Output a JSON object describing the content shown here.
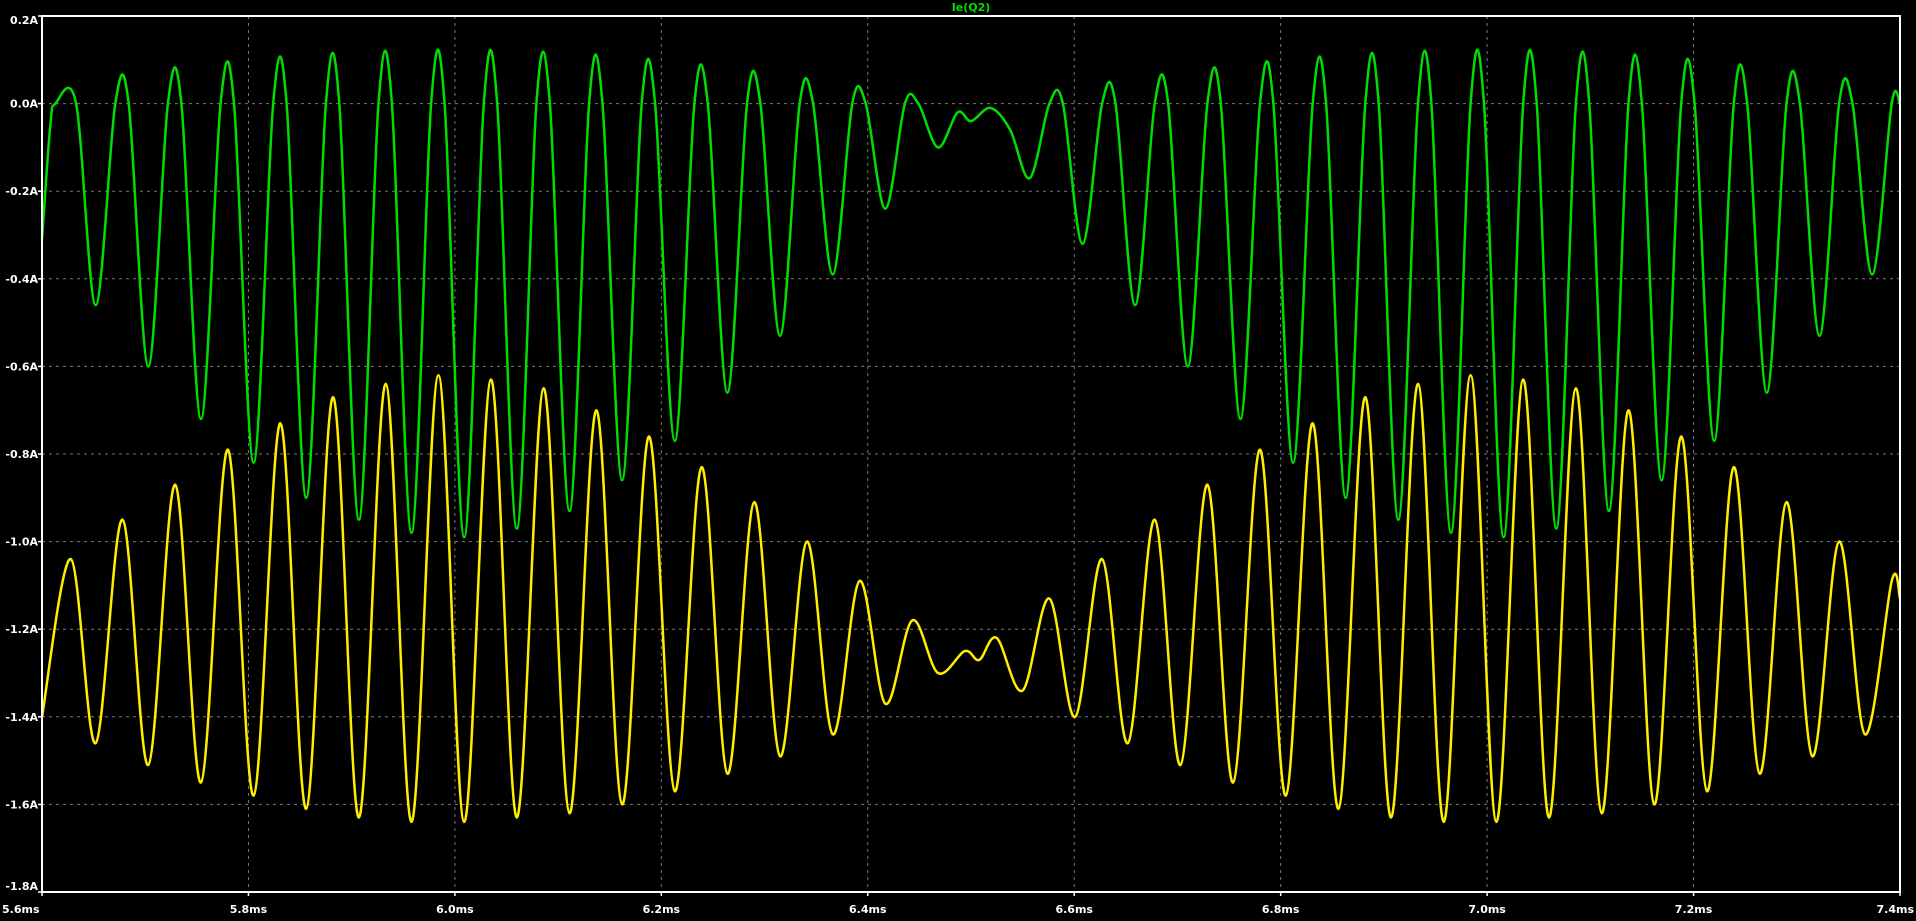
{
  "chart_data": {
    "type": "line",
    "title": "",
    "xlabel": "",
    "ylabel": "",
    "xlim": [
      5.6,
      7.4
    ],
    "ylim": [
      -1.8,
      0.2
    ],
    "grid": true,
    "x_ticks": [
      {
        "value": 5.6,
        "label": "5.6ms"
      },
      {
        "value": 5.8,
        "label": "5.8ms"
      },
      {
        "value": 6.0,
        "label": "6.0ms"
      },
      {
        "value": 6.2,
        "label": "6.2ms"
      },
      {
        "value": 6.4,
        "label": "6.4ms"
      },
      {
        "value": 6.6,
        "label": "6.6ms"
      },
      {
        "value": 6.8,
        "label": "6.8ms"
      },
      {
        "value": 7.0,
        "label": "7.0ms"
      },
      {
        "value": 7.2,
        "label": "7.2ms"
      },
      {
        "value": 7.4,
        "label": "7.4ms"
      }
    ],
    "y_ticks": [
      {
        "value": 0.2,
        "label": "0.2A"
      },
      {
        "value": 0.0,
        "label": "0.0A"
      },
      {
        "value": -0.2,
        "label": "-0.2A"
      },
      {
        "value": -0.4,
        "label": "-0.4A"
      },
      {
        "value": -0.6,
        "label": "-0.6A"
      },
      {
        "value": -0.8,
        "label": "-0.8A"
      },
      {
        "value": -1.0,
        "label": "-1.0A"
      },
      {
        "value": -1.2,
        "label": "-1.2A"
      },
      {
        "value": -1.4,
        "label": "-1.4A"
      },
      {
        "value": -1.6,
        "label": "-1.6A"
      },
      {
        "value": -1.8,
        "label": "-1.8A"
      }
    ],
    "legend": {
      "position": "top-center",
      "entries": [
        "Ie(Q2)"
      ]
    },
    "series": [
      {
        "name": "Ie(Q2)",
        "color": "#00dd00",
        "points": [
          [
            5.6,
            -0.31
          ],
          [
            5.608,
            -0.05
          ],
          [
            5.613,
            0.0
          ],
          [
            5.633,
            0.0
          ],
          [
            5.652,
            -0.46
          ],
          [
            5.671,
            0.0
          ],
          [
            5.684,
            0.0
          ],
          [
            5.703,
            -0.6
          ],
          [
            5.722,
            0.0
          ],
          [
            5.735,
            0.0
          ],
          [
            5.754,
            -0.72
          ],
          [
            5.773,
            0.0
          ],
          [
            5.786,
            0.0
          ],
          [
            5.805,
            -0.82
          ],
          [
            5.824,
            0.0
          ],
          [
            5.837,
            0.0
          ],
          [
            5.856,
            -0.9
          ],
          [
            5.875,
            0.0
          ],
          [
            5.888,
            0.0
          ],
          [
            5.907,
            -0.95
          ],
          [
            5.926,
            0.0
          ],
          [
            5.939,
            0.0
          ],
          [
            5.958,
            -0.98
          ],
          [
            5.977,
            0.0
          ],
          [
            5.99,
            0.0
          ],
          [
            6.009,
            -0.99
          ],
          [
            6.028,
            0.0
          ],
          [
            6.041,
            0.0
          ],
          [
            6.06,
            -0.97
          ],
          [
            6.079,
            0.0
          ],
          [
            6.092,
            0.0
          ],
          [
            6.111,
            -0.93
          ],
          [
            6.13,
            0.0
          ],
          [
            6.143,
            0.0
          ],
          [
            6.162,
            -0.86
          ],
          [
            6.181,
            0.0
          ],
          [
            6.194,
            0.0
          ],
          [
            6.213,
            -0.77
          ],
          [
            6.232,
            0.0
          ],
          [
            6.245,
            0.0
          ],
          [
            6.264,
            -0.66
          ],
          [
            6.283,
            0.0
          ],
          [
            6.296,
            0.0
          ],
          [
            6.315,
            -0.53
          ],
          [
            6.334,
            0.0
          ],
          [
            6.347,
            0.0
          ],
          [
            6.366,
            -0.39
          ],
          [
            6.385,
            0.0
          ],
          [
            6.398,
            0.0
          ],
          [
            6.417,
            -0.24
          ],
          [
            6.436,
            0.0
          ],
          [
            6.449,
            0.0
          ],
          [
            6.468,
            -0.1
          ],
          [
            6.487,
            -0.02
          ],
          [
            6.5,
            -0.04
          ],
          [
            6.519,
            -0.01
          ],
          [
            6.538,
            -0.06
          ],
          [
            6.557,
            -0.17
          ],
          [
            6.576,
            0.0
          ],
          [
            6.589,
            0.0
          ],
          [
            6.608,
            -0.32
          ],
          [
            6.627,
            0.0
          ],
          [
            6.64,
            0.0
          ],
          [
            6.659,
            -0.46
          ],
          [
            6.678,
            0.0
          ],
          [
            6.691,
            0.0
          ],
          [
            6.71,
            -0.6
          ],
          [
            6.729,
            0.0
          ],
          [
            6.742,
            0.0
          ],
          [
            6.761,
            -0.72
          ],
          [
            6.78,
            0.0
          ],
          [
            6.793,
            0.0
          ],
          [
            6.812,
            -0.82
          ],
          [
            6.831,
            0.0
          ],
          [
            6.844,
            0.0
          ],
          [
            6.863,
            -0.9
          ],
          [
            6.882,
            0.0
          ],
          [
            6.895,
            0.0
          ],
          [
            6.914,
            -0.95
          ],
          [
            6.933,
            0.0
          ],
          [
            6.946,
            0.0
          ],
          [
            6.965,
            -0.98
          ],
          [
            6.984,
            0.0
          ],
          [
            6.997,
            0.0
          ],
          [
            7.016,
            -0.99
          ],
          [
            7.035,
            0.0
          ],
          [
            7.048,
            0.0
          ],
          [
            7.067,
            -0.97
          ],
          [
            7.086,
            0.0
          ],
          [
            7.099,
            0.0
          ],
          [
            7.118,
            -0.93
          ],
          [
            7.137,
            0.0
          ],
          [
            7.15,
            0.0
          ],
          [
            7.169,
            -0.86
          ],
          [
            7.188,
            0.0
          ],
          [
            7.201,
            0.0
          ],
          [
            7.22,
            -0.77
          ],
          [
            7.239,
            0.0
          ],
          [
            7.252,
            0.0
          ],
          [
            7.271,
            -0.66
          ],
          [
            7.29,
            0.0
          ],
          [
            7.303,
            0.0
          ],
          [
            7.322,
            -0.53
          ],
          [
            7.341,
            0.0
          ],
          [
            7.354,
            0.0
          ],
          [
            7.373,
            -0.39
          ],
          [
            7.392,
            0.0
          ],
          [
            7.4,
            0.0
          ]
        ]
      },
      {
        "name": "",
        "color": "#ffee00",
        "points": [
          [
            5.6,
            -1.4
          ],
          [
            5.628,
            -1.04
          ],
          [
            5.652,
            -1.46
          ],
          [
            5.678,
            -0.95
          ],
          [
            5.703,
            -1.51
          ],
          [
            5.729,
            -0.87
          ],
          [
            5.754,
            -1.55
          ],
          [
            5.78,
            -0.79
          ],
          [
            5.805,
            -1.58
          ],
          [
            5.831,
            -0.73
          ],
          [
            5.856,
            -1.61
          ],
          [
            5.882,
            -0.67
          ],
          [
            5.907,
            -1.63
          ],
          [
            5.933,
            -0.64
          ],
          [
            5.958,
            -1.64
          ],
          [
            5.984,
            -0.62
          ],
          [
            6.009,
            -1.64
          ],
          [
            6.035,
            -0.63
          ],
          [
            6.06,
            -1.63
          ],
          [
            6.086,
            -0.65
          ],
          [
            6.111,
            -1.62
          ],
          [
            6.137,
            -0.7
          ],
          [
            6.162,
            -1.6
          ],
          [
            6.188,
            -0.76
          ],
          [
            6.213,
            -1.57
          ],
          [
            6.239,
            -0.83
          ],
          [
            6.264,
            -1.53
          ],
          [
            6.29,
            -0.91
          ],
          [
            6.315,
            -1.49
          ],
          [
            6.341,
            -1.0
          ],
          [
            6.366,
            -1.44
          ],
          [
            6.392,
            -1.09
          ],
          [
            6.417,
            -1.37
          ],
          [
            6.443,
            -1.18
          ],
          [
            6.468,
            -1.3
          ],
          [
            6.494,
            -1.25
          ],
          [
            6.508,
            -1.27
          ],
          [
            6.525,
            -1.22
          ],
          [
            6.55,
            -1.34
          ],
          [
            6.576,
            -1.13
          ],
          [
            6.601,
            -1.4
          ],
          [
            6.627,
            -1.04
          ],
          [
            6.652,
            -1.46
          ],
          [
            6.678,
            -0.95
          ],
          [
            6.703,
            -1.51
          ],
          [
            6.729,
            -0.87
          ],
          [
            6.754,
            -1.55
          ],
          [
            6.78,
            -0.79
          ],
          [
            6.805,
            -1.58
          ],
          [
            6.831,
            -0.73
          ],
          [
            6.856,
            -1.61
          ],
          [
            6.882,
            -0.67
          ],
          [
            6.907,
            -1.63
          ],
          [
            6.933,
            -0.64
          ],
          [
            6.958,
            -1.64
          ],
          [
            6.984,
            -0.62
          ],
          [
            7.009,
            -1.64
          ],
          [
            7.035,
            -0.63
          ],
          [
            7.06,
            -1.63
          ],
          [
            7.086,
            -0.65
          ],
          [
            7.111,
            -1.62
          ],
          [
            7.137,
            -0.7
          ],
          [
            7.162,
            -1.6
          ],
          [
            7.188,
            -0.76
          ],
          [
            7.213,
            -1.57
          ],
          [
            7.239,
            -0.83
          ],
          [
            7.264,
            -1.53
          ],
          [
            7.29,
            -0.91
          ],
          [
            7.315,
            -1.49
          ],
          [
            7.341,
            -1.0
          ],
          [
            7.366,
            -1.44
          ],
          [
            7.392,
            -1.09
          ],
          [
            7.4,
            -1.13
          ]
        ]
      }
    ]
  },
  "style": {
    "background": "#000000",
    "frame_color": "#ffffff",
    "grid_color": "#7a7a7a",
    "tick_label_color": "#ffffff",
    "legend_color": "#00dd00"
  }
}
